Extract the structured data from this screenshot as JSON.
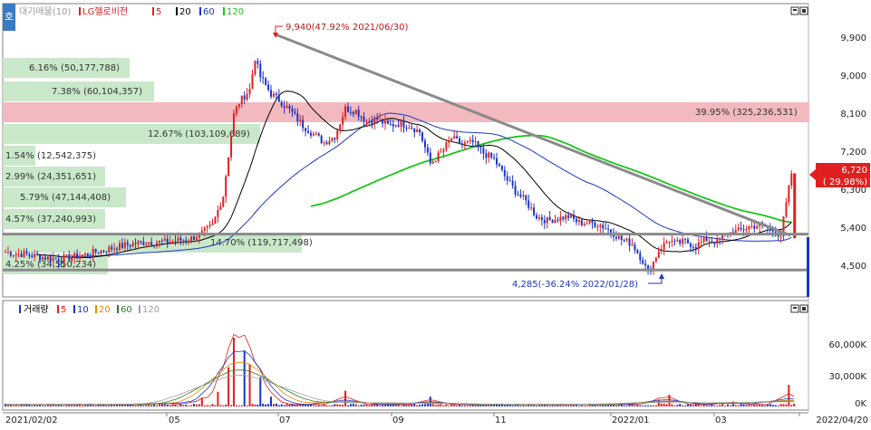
{
  "header": {
    "tab_icon_glyph": "호",
    "indicator_label": "대기매물(10)",
    "stock_name": "LG헬로비전",
    "ma": [
      {
        "label": "5",
        "color": "#e02020"
      },
      {
        "label": "20",
        "color": "#000000"
      },
      {
        "label": "60",
        "color": "#1a35c8"
      },
      {
        "label": "120",
        "color": "#19c419"
      }
    ]
  },
  "volume_header": {
    "label": "거래량",
    "ma": [
      {
        "label": "5",
        "color": "#e02020"
      },
      {
        "label": "10",
        "color": "#1a35c8"
      },
      {
        "label": "20",
        "color": "#e08a00"
      },
      {
        "label": "60",
        "color": "#2a7a2a"
      },
      {
        "label": "120",
        "color": "#a0a0a0"
      }
    ]
  },
  "annotations": {
    "high": "9,940(47.92% 2021/06/30)",
    "low": "4,285(-36.24% 2022/01/28)",
    "current_price": "6,720",
    "current_change": "( 29.98%)"
  },
  "volume_profile": [
    {
      "label": "6.16% (50,177,788)",
      "highlight": false
    },
    {
      "label": "7.38% (60,104,357)",
      "highlight": false
    },
    {
      "label": "39.95% (325,236,531)",
      "highlight": true
    },
    {
      "label": "12.67% (103,109,689)",
      "highlight": false
    },
    {
      "label": "1.54% (12,542,375)",
      "highlight": false
    },
    {
      "label": "2.99% (24,351,651)",
      "highlight": false
    },
    {
      "label": "5.79% (47,144,408)",
      "highlight": false
    },
    {
      "label": "4.57% (37,240,993)",
      "highlight": false
    },
    {
      "label": "14.70% (119,717,498)",
      "highlight": false
    },
    {
      "label": "4.25% (34,550,234)",
      "highlight": false
    }
  ],
  "colors": {
    "up": "#e02020",
    "down": "#1a35c8",
    "ma5": "#e02020",
    "ma20": "#000000",
    "ma60": "#1a35c8",
    "ma120": "#19c419",
    "trendline": "#8a8a8a",
    "support": "#8a8a8a",
    "profile": "#c9e8c9",
    "profile_highlight": "#f2b9be",
    "price_tag": "#e02020"
  },
  "chart_data": {
    "type": "candlestick",
    "price_axis": {
      "ticks": [
        "9,900",
        "9,000",
        "8,100",
        "7,200",
        "6,300",
        "5,400",
        "4,500"
      ],
      "range": [
        4030,
        10250
      ]
    },
    "volume_axis": {
      "ticks": [
        "60,000K",
        "30,000K",
        "0K"
      ],
      "range": [
        0,
        80000
      ]
    },
    "x_labels": [
      "2021/02/02",
      "05",
      "07",
      "09",
      "11",
      "2022/01",
      "03",
      "2022/04/20"
    ],
    "high": {
      "price": 9940,
      "change_pct": 47.92,
      "date": "2021/06/30"
    },
    "low": {
      "price": 4285,
      "change_pct": -36.24,
      "date": "2022/01/28"
    },
    "last": {
      "price": 6720,
      "change_pct": 29.98,
      "date": "2022/04/20"
    },
    "support_lines": [
      5280,
      4430
    ],
    "trendline": {
      "from": {
        "date": "2021/06/30",
        "price": 9940
      },
      "to": {
        "date": "2022/04/19",
        "price": 5250
      }
    },
    "price_path": [
      [
        0,
        4850
      ],
      [
        8,
        4800
      ],
      [
        14,
        4730
      ],
      [
        20,
        4680
      ],
      [
        28,
        4770
      ],
      [
        36,
        4880
      ],
      [
        42,
        4980
      ],
      [
        48,
        5050
      ],
      [
        54,
        5100
      ],
      [
        60,
        5090
      ],
      [
        66,
        5140
      ],
      [
        70,
        5180
      ],
      [
        74,
        5300
      ],
      [
        78,
        5480
      ],
      [
        82,
        6200
      ],
      [
        86,
        8100
      ],
      [
        88,
        8400
      ],
      [
        92,
        8700
      ],
      [
        94,
        9450
      ],
      [
        96,
        9000
      ],
      [
        100,
        8600
      ],
      [
        104,
        8400
      ],
      [
        108,
        8150
      ],
      [
        112,
        7850
      ],
      [
        116,
        7650
      ],
      [
        120,
        7450
      ],
      [
        124,
        7600
      ],
      [
        128,
        8250
      ],
      [
        132,
        8200
      ],
      [
        136,
        7950
      ],
      [
        140,
        8000
      ],
      [
        144,
        7850
      ],
      [
        148,
        7900
      ],
      [
        152,
        7850
      ],
      [
        156,
        7700
      ],
      [
        160,
        6950
      ],
      [
        164,
        7200
      ],
      [
        168,
        7550
      ],
      [
        172,
        7400
      ],
      [
        176,
        7450
      ],
      [
        180,
        7200
      ],
      [
        184,
        7050
      ],
      [
        188,
        6650
      ],
      [
        192,
        6300
      ],
      [
        196,
        6050
      ],
      [
        200,
        5700
      ],
      [
        204,
        5600
      ],
      [
        208,
        5650
      ],
      [
        212,
        5700
      ],
      [
        216,
        5550
      ],
      [
        220,
        5550
      ],
      [
        224,
        5500
      ],
      [
        228,
        5350
      ],
      [
        232,
        5150
      ],
      [
        236,
        5050
      ],
      [
        240,
        4650
      ],
      [
        242,
        4350
      ],
      [
        246,
        4900
      ],
      [
        250,
        5150
      ],
      [
        252,
        5050
      ],
      [
        256,
        5100
      ],
      [
        260,
        5000
      ],
      [
        264,
        5150
      ],
      [
        268,
        5100
      ],
      [
        272,
        5300
      ],
      [
        276,
        5350
      ],
      [
        280,
        5450
      ],
      [
        284,
        5500
      ],
      [
        288,
        5400
      ],
      [
        292,
        5250
      ],
      [
        296,
        6720
      ]
    ],
    "volume_spikes": [
      [
        60,
        3000
      ],
      [
        74,
        9000
      ],
      [
        80,
        15000
      ],
      [
        84,
        40000
      ],
      [
        86,
        70000
      ],
      [
        90,
        57000
      ],
      [
        92,
        43000
      ],
      [
        96,
        30000
      ],
      [
        100,
        10000
      ],
      [
        128,
        16000
      ],
      [
        160,
        10000
      ],
      [
        246,
        7000
      ],
      [
        250,
        12000
      ],
      [
        274,
        5000
      ],
      [
        295,
        22000
      ]
    ]
  }
}
